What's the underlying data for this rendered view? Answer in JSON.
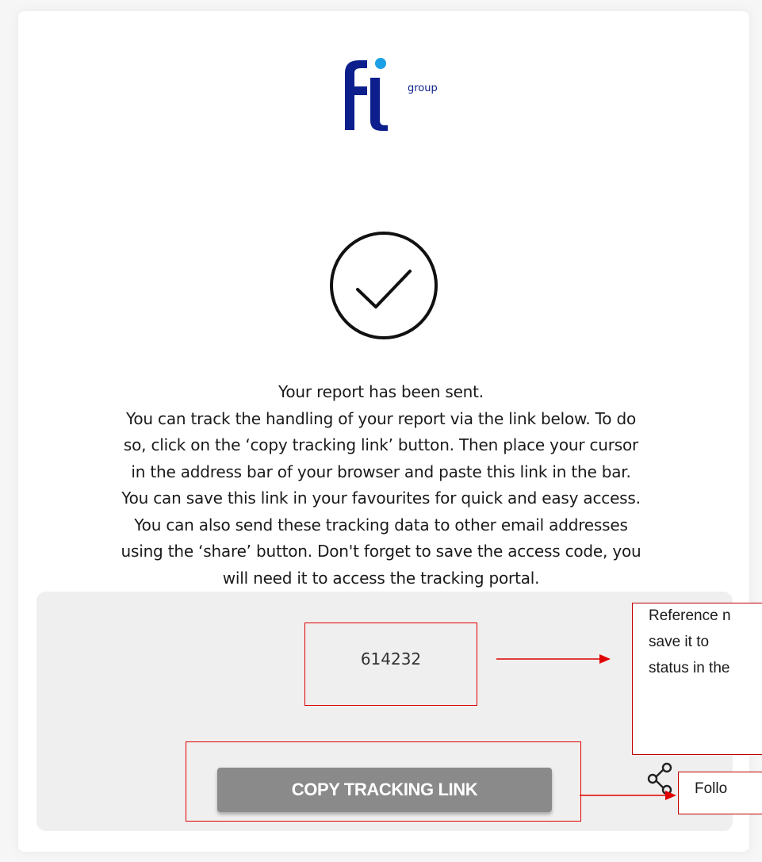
{
  "logo": {
    "brand": "fi",
    "sub": "group",
    "colors": {
      "navy": "#0d1f8c",
      "dot": "#1aa0e6"
    }
  },
  "success_icon": "check-circle-icon",
  "message": {
    "lines": [
      "Your report has been sent.",
      "You can track the handling of your report via the link below. To do",
      "so, click on the ‘copy tracking link’ button. Then place your cursor",
      "in the address bar of your browser and paste this link in the bar.",
      "You can save this link in your favourites for quick and easy access.",
      "You can also send these tracking data to other email addresses",
      "using the ‘share’ button. Don't forget to save the access code, you",
      "will need it to access the tracking portal."
    ]
  },
  "tracking": {
    "code": "614232",
    "copy_button_label": "COPY TRACKING LINK",
    "share_icon": "share-icon"
  },
  "annotations": {
    "reference_lines": [
      "Reference n",
      "save  it  to",
      "status in the"
    ],
    "follow_text": "Follo",
    "color": "#e00000"
  }
}
